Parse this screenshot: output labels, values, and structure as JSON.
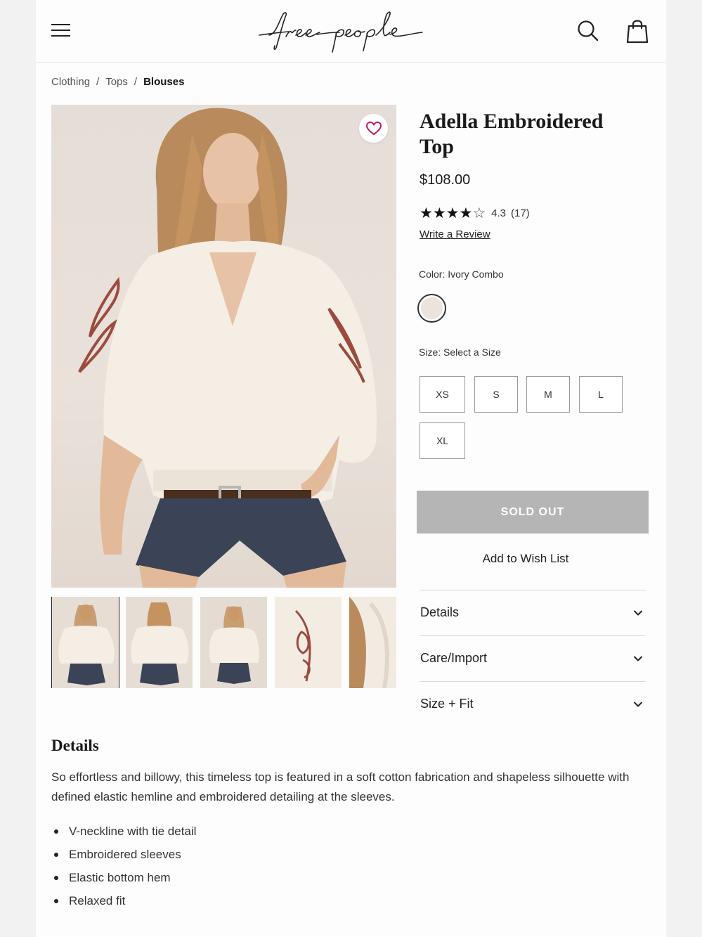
{
  "brand": {
    "logo_text": "free people"
  },
  "breadcrumb": {
    "items": [
      "Clothing",
      "Tops"
    ],
    "current": "Blouses",
    "separator": "/"
  },
  "product": {
    "title": "Adella Embroidered Top",
    "price": "$108.00",
    "rating": {
      "value": 4.3,
      "stars_filled": 4,
      "stars_total": 5,
      "value_text": "4.3",
      "count_text": "(17)"
    },
    "write_review_label": "Write a Review",
    "color": {
      "label": "Color:",
      "selected": "Ivory Combo",
      "swatch_hex": "#ece3dc"
    },
    "size": {
      "label": "Size:",
      "prompt": "Select a Size",
      "options": [
        "XS",
        "S",
        "M",
        "L",
        "XL"
      ]
    },
    "soldout_label": "SOLD OUT",
    "wishlist_label": "Add to Wish List",
    "accordions": [
      "Details",
      "Care/Import",
      "Size + Fit"
    ]
  },
  "details": {
    "heading": "Details",
    "description": "So effortless and billowy, this timeless top is featured in a soft cotton fabrication and shapeless silhouette with defined elastic hemline and embroidered detailing at the sleeves.",
    "bullets": [
      "V-neckline with tie detail",
      "Embroidered sleeves",
      "Elastic bottom hem",
      "Relaxed fit"
    ]
  },
  "icons": {
    "menu": "hamburger-menu-icon",
    "search": "search-icon",
    "bag": "shopping-bag-icon",
    "favorite": "heart-icon",
    "star": "star-icon",
    "chevron": "chevron-down-icon"
  },
  "colors": {
    "accent_heart": "#c2185b",
    "soldout_bg": "#b5b5b5",
    "text": "#222222"
  }
}
